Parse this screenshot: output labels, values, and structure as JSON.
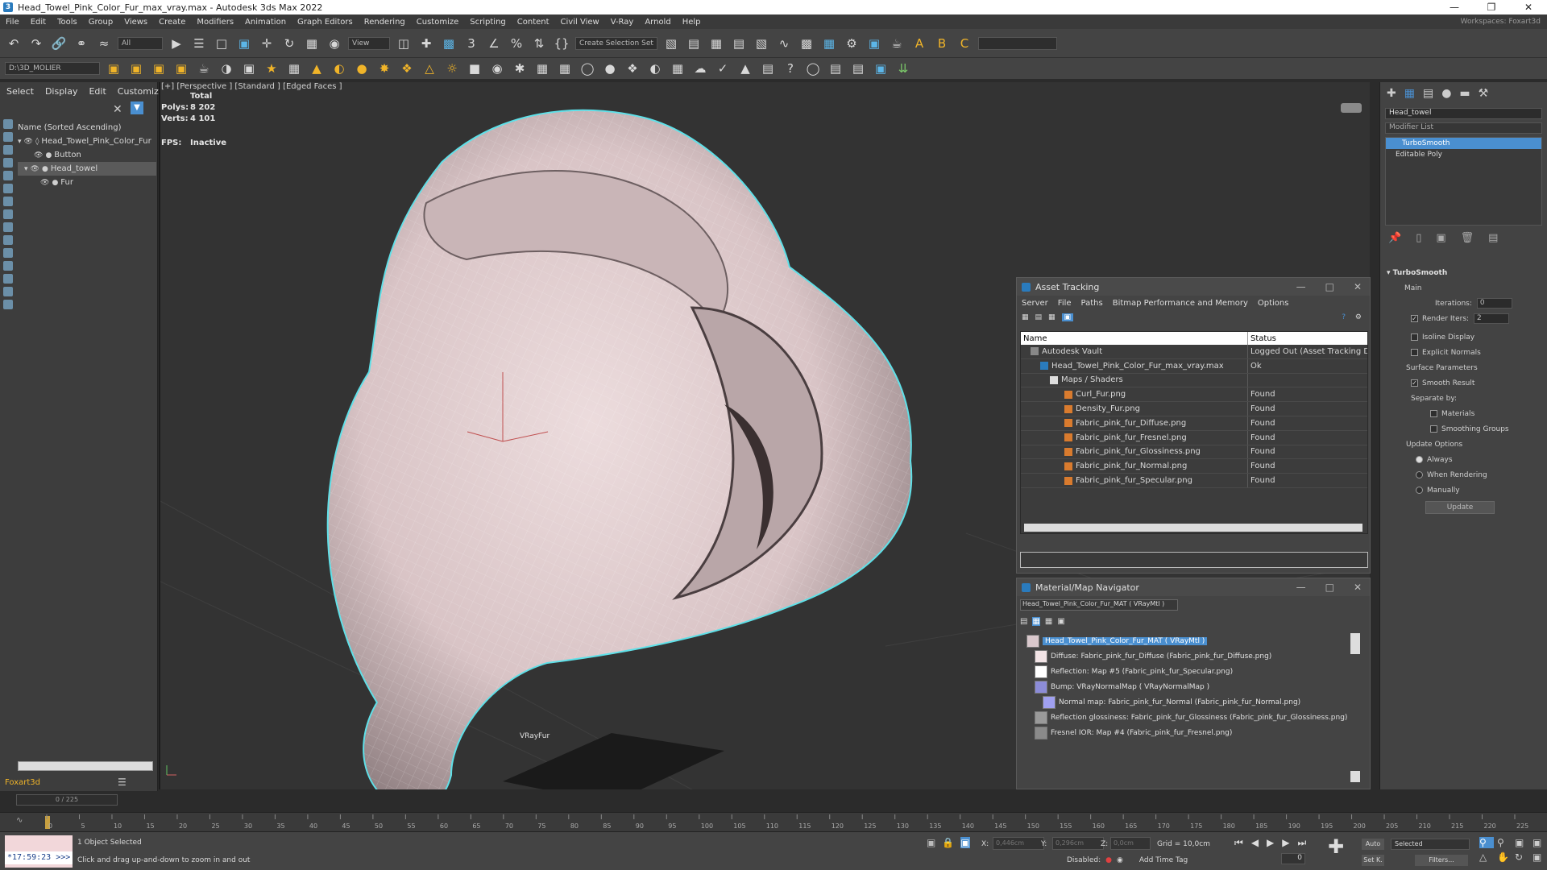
{
  "window": {
    "title": "Head_Towel_Pink_Color_Fur_max_vray.max - Autodesk 3ds Max 2022",
    "workspaces_label": "Workspaces:",
    "workspace_value": "Foxart3d"
  },
  "menu": [
    "File",
    "Edit",
    "Tools",
    "Group",
    "Views",
    "Create",
    "Modifiers",
    "Animation",
    "Graph Editors",
    "Rendering",
    "Customize",
    "Scripting",
    "Content",
    "Civil View",
    "V-Ray",
    "Arnold",
    "Help"
  ],
  "toolbar": {
    "filter_all": "All",
    "view_dropdown": "View",
    "selection_set": "Create Selection Set",
    "project_path": "D:\\3D_MOLIER"
  },
  "scene_explorer": {
    "tabs": [
      "Select",
      "Display",
      "Edit",
      "Customize"
    ],
    "column_header": "Name (Sorted Ascending)",
    "items": [
      {
        "label": "Head_Towel_Pink_Color_Fur"
      },
      {
        "label": "Button"
      },
      {
        "label": "Head_towel"
      },
      {
        "label": "Fur"
      }
    ],
    "footer_name": "Foxart3d"
  },
  "viewport": {
    "label": "[+] [Perspective ] [Standard ] [Edged Faces ]",
    "stats_total": "Total",
    "stats_polys_label": "Polys:",
    "stats_polys": "8 202",
    "stats_verts_label": "Verts:",
    "stats_verts": "4 101",
    "fps_label": "FPS:",
    "fps_value": "Inactive",
    "vrayfur_label": "VRayFur"
  },
  "asset_tracking": {
    "title": "Asset Tracking",
    "menu": [
      "Server",
      "File",
      "Paths",
      "Bitmap Performance and Memory",
      "Options"
    ],
    "columns": [
      "Name",
      "Status"
    ],
    "rows": [
      {
        "name": "Autodesk Vault",
        "status": "Logged Out (Asset Tracking Disa"
      },
      {
        "name": "Head_Towel_Pink_Color_Fur_max_vray.max",
        "status": "Ok"
      },
      {
        "name": "Maps / Shaders",
        "status": ""
      },
      {
        "name": "Curl_Fur.png",
        "status": "Found"
      },
      {
        "name": "Density_Fur.png",
        "status": "Found"
      },
      {
        "name": "Fabric_pink_fur_Diffuse.png",
        "status": "Found"
      },
      {
        "name": "Fabric_pink_fur_Fresnel.png",
        "status": "Found"
      },
      {
        "name": "Fabric_pink_fur_Glossiness.png",
        "status": "Found"
      },
      {
        "name": "Fabric_pink_fur_Normal.png",
        "status": "Found"
      },
      {
        "name": "Fabric_pink_fur_Specular.png",
        "status": "Found"
      }
    ]
  },
  "material_navigator": {
    "title": "Material/Map Navigator",
    "current": "Head_Towel_Pink_Color_Fur_MAT  ( VRayMtl )",
    "items": [
      {
        "label": "Head_Towel_Pink_Color_Fur_MAT  ( VRayMtl )",
        "swatch": "#d9c8cc"
      },
      {
        "label": "Diffuse: Fabric_pink_fur_Diffuse (Fabric_pink_fur_Diffuse.png)",
        "swatch": "#f2e4e6"
      },
      {
        "label": "Reflection: Map #5 (Fabric_pink_fur_Specular.png)",
        "swatch": "#ffffff"
      },
      {
        "label": "Bump: VRayNormalMap  ( VRayNormalMap )",
        "swatch": "#8c8cd8"
      },
      {
        "label": "Normal map: Fabric_pink_fur_Normal (Fabric_pink_fur_Normal.png)",
        "swatch": "#a0a0f0"
      },
      {
        "label": "Reflection glossiness: Fabric_pink_fur_Glossiness (Fabric_pink_fur_Glossiness.png)",
        "swatch": "#9a9a9a"
      },
      {
        "label": "Fresnel IOR: Map #4 (Fabric_pink_fur_Fresnel.png)",
        "swatch": "#8a8a8a"
      }
    ]
  },
  "command_panel": {
    "object_name": "Head_towel",
    "modifier_list_label": "Modifier List",
    "stack": [
      "TurboSmooth",
      "Editable Poly"
    ],
    "rollout_title": "TurboSmooth",
    "main_label": "Main",
    "iterations_label": "Iterations:",
    "iterations_value": "0",
    "render_iters_label": "Render Iters:",
    "render_iters_value": "2",
    "isoline_label": "Isoline Display",
    "explicit_normals_label": "Explicit Normals",
    "surface_params_label": "Surface Parameters",
    "smooth_result_label": "Smooth Result",
    "separate_by_label": "Separate by:",
    "materials_label": "Materials",
    "smoothing_groups_label": "Smoothing Groups",
    "update_options_label": "Update Options",
    "always_label": "Always",
    "when_rendering_label": "When Rendering",
    "manually_label": "Manually",
    "update_button": "Update"
  },
  "timeline": {
    "frame_counter": "0 / 225",
    "ticks": [
      "0",
      "5",
      "10",
      "15",
      "20",
      "25",
      "30",
      "35",
      "40",
      "45",
      "50",
      "55",
      "60",
      "65",
      "70",
      "75",
      "80",
      "85",
      "90",
      "95",
      "100",
      "105",
      "110",
      "115",
      "120",
      "125",
      "130",
      "135",
      "140",
      "145",
      "150",
      "155",
      "160",
      "165",
      "170",
      "175",
      "180",
      "185",
      "190",
      "195",
      "200",
      "205",
      "210",
      "215",
      "220",
      "225"
    ]
  },
  "status": {
    "clock": "*17:59:23 >>>",
    "selected": "1 Object Selected",
    "prompt": "Click and drag up-and-down to zoom in and out",
    "x_label": "X:",
    "x_value": "0,446cm",
    "y_label": "Y:",
    "y_value": "0,296cm",
    "z_label": "Z:",
    "z_value": "0,0cm",
    "grid": "Grid = 10,0cm",
    "disabled_label": "Disabled:",
    "add_time_tag": "Add Time Tag",
    "auto_label": "Auto",
    "setk_label": "Set K.",
    "selected_dropdown": "Selected",
    "filters_label": "Filters...",
    "frame_value": "0"
  },
  "colors": {
    "towel_fill": "#e6d2d4",
    "selection_outline": "#5fe0e8",
    "accent_blue": "#4a8fd0"
  }
}
